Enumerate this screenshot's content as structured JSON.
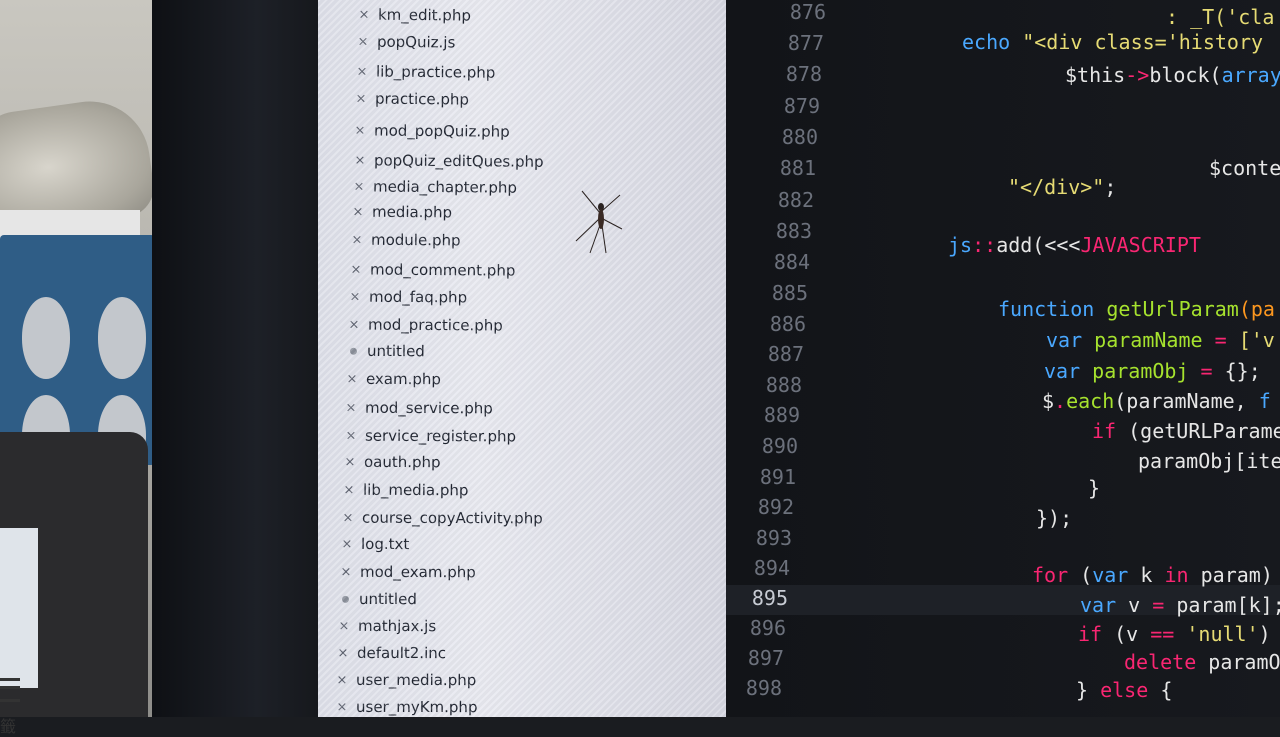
{
  "file_list": [
    {
      "name": "km_edit.php",
      "status": "close"
    },
    {
      "name": "popQuiz.js",
      "status": "close"
    },
    {
      "name": "lib_practice.php",
      "status": "close"
    },
    {
      "name": "practice.php",
      "status": "close"
    },
    {
      "name": "mod_popQuiz.php",
      "status": "close"
    },
    {
      "name": "popQuiz_editQues.php",
      "status": "close"
    },
    {
      "name": "media_chapter.php",
      "status": "close"
    },
    {
      "name": "media.php",
      "status": "close"
    },
    {
      "name": "module.php",
      "status": "close"
    },
    {
      "name": "mod_comment.php",
      "status": "close"
    },
    {
      "name": "mod_faq.php",
      "status": "close"
    },
    {
      "name": "mod_practice.php",
      "status": "close"
    },
    {
      "name": "untitled",
      "status": "dirty"
    },
    {
      "name": "exam.php",
      "status": "close"
    },
    {
      "name": "mod_service.php",
      "status": "close"
    },
    {
      "name": "service_register.php",
      "status": "close"
    },
    {
      "name": "oauth.php",
      "status": "close"
    },
    {
      "name": "lib_media.php",
      "status": "close"
    },
    {
      "name": "course_copyActivity.php",
      "status": "close"
    },
    {
      "name": "log.txt",
      "status": "close"
    },
    {
      "name": "mod_exam.php",
      "status": "close"
    },
    {
      "name": "untitled",
      "status": "dirty"
    },
    {
      "name": "mathjax.js",
      "status": "close"
    },
    {
      "name": "default2.inc",
      "status": "close"
    },
    {
      "name": "user_media.php",
      "status": "close"
    },
    {
      "name": "user_myKm.php",
      "status": "close"
    }
  ],
  "editor": {
    "line_numbers": [
      "876",
      "877",
      "878",
      "879",
      "880",
      "881",
      "882",
      "883",
      "884",
      "885",
      "886",
      "887",
      "888",
      "889",
      "890",
      "891",
      "892",
      "893",
      "894",
      "895",
      "896",
      "897",
      "898"
    ],
    "current_line": "895",
    "code": [
      {
        "tokens": [
          {
            "t": ": _T('cla",
            "c": "str"
          }
        ]
      },
      {
        "tokens": [
          {
            "t": "echo ",
            "c": "kw"
          },
          {
            "t": "\"<div class='history",
            "c": "str"
          }
        ]
      },
      {
        "tokens": [
          {
            "t": "$this",
            "c": ""
          },
          {
            "t": "->",
            "c": "red"
          },
          {
            "t": "block(",
            "c": ""
          },
          {
            "t": "array",
            "c": "kw"
          }
        ]
      },
      {
        "tokens": []
      },
      {
        "tokens": []
      },
      {
        "tokens": [
          {
            "t": "$conte",
            "c": ""
          }
        ]
      },
      {
        "tokens": [
          {
            "t": "\"</div>\"",
            "c": "str"
          },
          {
            "t": ";",
            "c": ""
          }
        ]
      },
      {
        "tokens": []
      },
      {
        "tokens": [
          {
            "t": "js",
            "c": "kw"
          },
          {
            "t": "::",
            "c": "red"
          },
          {
            "t": "add(<<<",
            "c": ""
          },
          {
            "t": "JAVASCRIPT",
            "c": "hd"
          }
        ]
      },
      {
        "tokens": []
      },
      {
        "tokens": [
          {
            "t": "function ",
            "c": "kw"
          },
          {
            "t": "getUrlParam",
            "c": "fn"
          },
          {
            "t": "(pa",
            "c": "var"
          }
        ]
      },
      {
        "tokens": [
          {
            "t": "var ",
            "c": "kw"
          },
          {
            "t": "paramName ",
            "c": "fn"
          },
          {
            "t": "= ",
            "c": "red"
          },
          {
            "t": "['v",
            "c": "str"
          }
        ]
      },
      {
        "tokens": [
          {
            "t": "var ",
            "c": "kw"
          },
          {
            "t": "paramObj ",
            "c": "fn"
          },
          {
            "t": "= ",
            "c": "red"
          },
          {
            "t": "{};",
            "c": ""
          }
        ]
      },
      {
        "tokens": [
          {
            "t": "$",
            "c": ""
          },
          {
            "t": ".",
            "c": "red"
          },
          {
            "t": "each",
            "c": "fn"
          },
          {
            "t": "(paramName, ",
            "c": ""
          },
          {
            "t": "f",
            "c": "kw"
          }
        ]
      },
      {
        "tokens": [
          {
            "t": "if ",
            "c": "red"
          },
          {
            "t": "(getURLParame",
            "c": ""
          }
        ]
      },
      {
        "tokens": [
          {
            "t": "paramObj[ite",
            "c": ""
          }
        ]
      },
      {
        "tokens": [
          {
            "t": "}",
            "c": ""
          }
        ]
      },
      {
        "tokens": [
          {
            "t": "});",
            "c": ""
          }
        ]
      },
      {
        "tokens": []
      },
      {
        "tokens": [
          {
            "t": "for ",
            "c": "red"
          },
          {
            "t": "(",
            "c": ""
          },
          {
            "t": "var ",
            "c": "kw"
          },
          {
            "t": "k ",
            "c": ""
          },
          {
            "t": "in ",
            "c": "red"
          },
          {
            "t": "param)",
            "c": ""
          }
        ]
      },
      {
        "tokens": [
          {
            "t": "var ",
            "c": "kw"
          },
          {
            "t": "v ",
            "c": ""
          },
          {
            "t": "= ",
            "c": "red"
          },
          {
            "t": "param[k];",
            "c": ""
          }
        ]
      },
      {
        "tokens": [
          {
            "t": "if ",
            "c": "red"
          },
          {
            "t": "(v ",
            "c": ""
          },
          {
            "t": "== ",
            "c": "red"
          },
          {
            "t": "'null'",
            "c": "str"
          },
          {
            "t": ")",
            "c": ""
          }
        ]
      },
      {
        "tokens": [
          {
            "t": "delete ",
            "c": "red"
          },
          {
            "t": "paramO",
            "c": ""
          }
        ]
      },
      {
        "tokens": [
          {
            "t": "} ",
            "c": ""
          },
          {
            "t": "else ",
            "c": "red"
          },
          {
            "t": "{",
            "c": ""
          }
        ]
      }
    ]
  },
  "phone": {
    "glyph": "籤"
  }
}
